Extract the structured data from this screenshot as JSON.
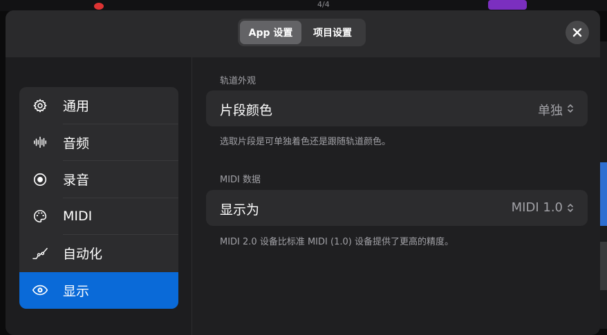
{
  "background_toolbar": {
    "counter": "4/4"
  },
  "header": {
    "tabs": [
      {
        "label": "App 设置",
        "active": true
      },
      {
        "label": "项目设置",
        "active": false
      }
    ],
    "close_icon": "close-icon"
  },
  "sidebar": {
    "items": [
      {
        "label": "通用",
        "icon": "gear-icon"
      },
      {
        "label": "音频",
        "icon": "waveform-icon"
      },
      {
        "label": "录音",
        "icon": "record-icon"
      },
      {
        "label": "MIDI",
        "icon": "palette-icon"
      },
      {
        "label": "自动化",
        "icon": "automation-icon"
      },
      {
        "label": "显示",
        "icon": "eye-icon",
        "selected": true
      }
    ]
  },
  "content": {
    "track_section": {
      "title": "轨道外观",
      "row_label": "片段颜色",
      "row_value": "单独",
      "footnote": "选取片段是可单独着色还是跟随轨道颜色。"
    },
    "midi_section": {
      "title": "MIDI 数据",
      "row_label": "显示为",
      "row_value": "MIDI 1.0",
      "footnote": "MIDI 2.0 设备比标准 MIDI (1.0) 设备提供了更高的精度。"
    }
  },
  "colors": {
    "accent": "#0a6ad8",
    "sheet_bg": "#1f1f21",
    "header_bg": "#2a2a2c",
    "card_bg": "#2c2c2e",
    "secondary_text": "#a1a1a6"
  }
}
